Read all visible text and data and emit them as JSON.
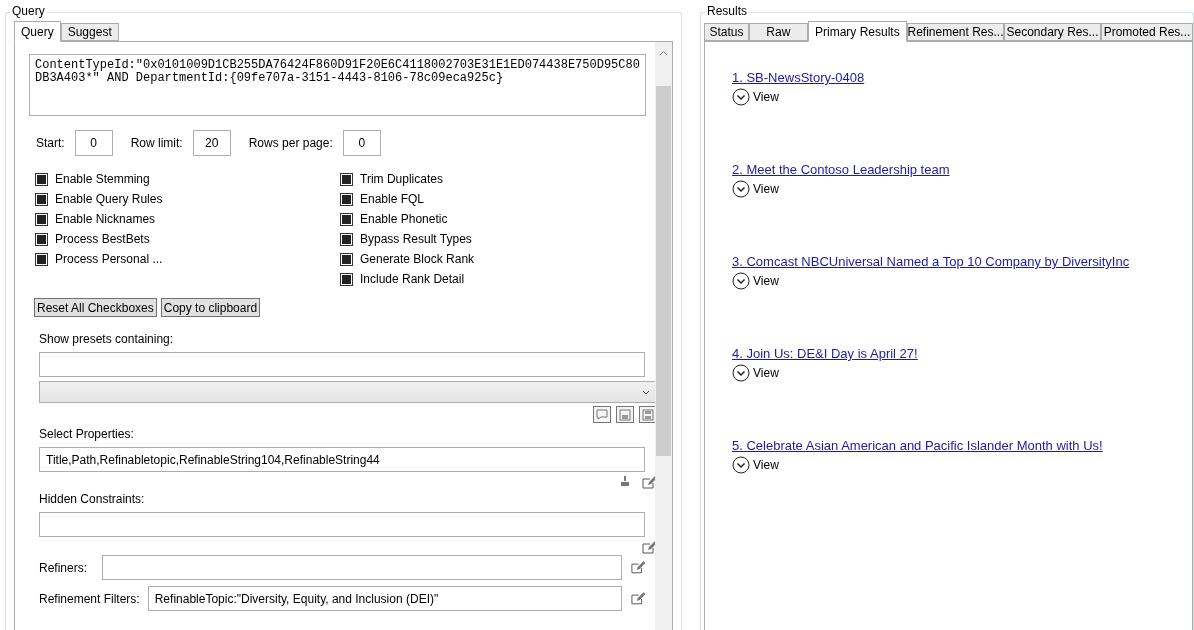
{
  "query_panel": {
    "title": "Query",
    "tabs": [
      {
        "label": "Query",
        "selected": true
      },
      {
        "label": "Suggest",
        "selected": false
      }
    ],
    "query_text": "ContentTypeId:\"0x0101009D1CB255DA76424F860D91F20E6C4118002703E31E1ED074438E750D95C80DB3A403*\" AND DepartmentId:{09fe707a-3151-4443-8106-78c09eca925c}",
    "paging": [
      {
        "label": "Start:",
        "value": "0"
      },
      {
        "label": "Row limit:",
        "value": "20"
      },
      {
        "label": "Rows per page:",
        "value": "0"
      }
    ],
    "options_left": [
      {
        "label": "Enable Stemming",
        "checked": true
      },
      {
        "label": "Enable Query Rules",
        "checked": true
      },
      {
        "label": "Enable Nicknames",
        "checked": true
      },
      {
        "label": "Process BestBets",
        "checked": true
      },
      {
        "label": "Process Personal ...",
        "checked": true
      }
    ],
    "options_right": [
      {
        "label": "Trim Duplicates",
        "checked": true
      },
      {
        "label": "Enable FQL",
        "checked": true
      },
      {
        "label": "Enable Phonetic",
        "checked": true
      },
      {
        "label": "Bypass Result Types",
        "checked": true
      },
      {
        "label": "Generate Block Rank",
        "checked": true
      },
      {
        "label": "Include Rank Detail",
        "checked": true
      }
    ],
    "buttons": [
      "Reset All Checkboxes",
      "Copy to clipboard"
    ],
    "presets_label": "Show presets containing:",
    "select_properties": {
      "label": "Select Properties:",
      "value": "Title,Path,Refinabletopic,RefinableString104,RefinableString44"
    },
    "hidden_constraints": {
      "label": "Hidden Constraints:"
    },
    "refiners": {
      "label": "Refiners:"
    },
    "refinement_filters": {
      "label": "Refinement Filters:",
      "value": "RefinableTopic:\"Diversity, Equity, and Inclusion (DEI)\""
    }
  },
  "results_panel": {
    "title": "Results",
    "tabs": [
      {
        "label": "Status",
        "selected": false
      },
      {
        "label": "Raw",
        "selected": false
      },
      {
        "label": "Primary Results",
        "selected": true
      },
      {
        "label": "Refinement Res...",
        "selected": false
      },
      {
        "label": "Secondary Res...",
        "selected": false
      },
      {
        "label": "Promoted Res...",
        "selected": false
      }
    ],
    "results": [
      {
        "title": "1. SB-NewsStory-0408",
        "action": "View"
      },
      {
        "title": "2. Meet the Contoso Leadership team",
        "action": "View"
      },
      {
        "title": "3. Comcast NBCUniversal Named a Top 10 Company by DiversityInc",
        "action": "View"
      },
      {
        "title": "4. Join Us: DE&I Day is April 27!",
        "action": "View"
      },
      {
        "title": "5. Celebrate Asian American and Pacific Islander Month with Us!",
        "action": "View"
      }
    ]
  }
}
